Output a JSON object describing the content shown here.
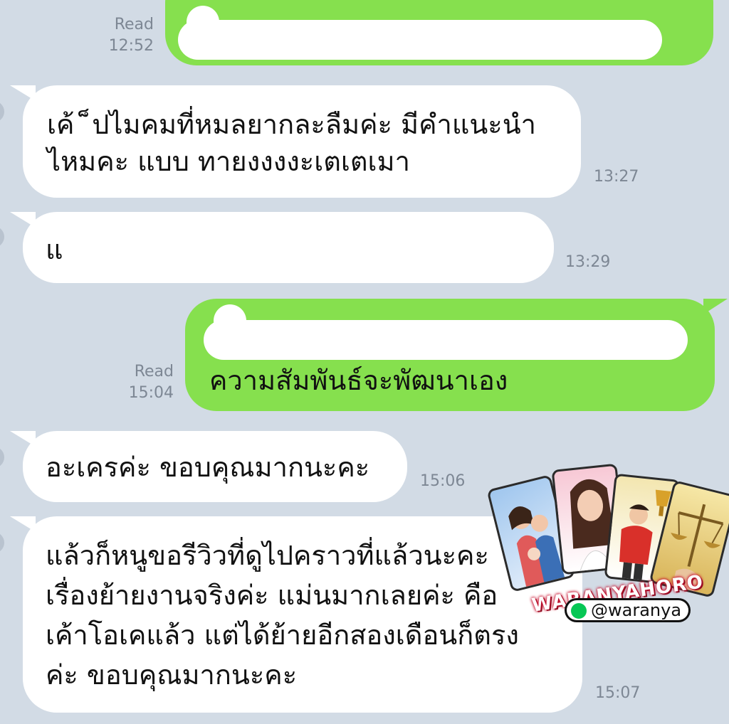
{
  "colors": {
    "background": "#d2dbe5",
    "incoming": "#ffffff",
    "outgoing": "#86e04e",
    "meta": "#7d8794"
  },
  "messages": [
    {
      "id": "m1",
      "direction": "out",
      "read_label": "Read",
      "time": "12:52",
      "lines": []
    },
    {
      "id": "m2",
      "direction": "in",
      "time": "13:27",
      "lines": [
        "เค้  ็ปไมคมที่หมลยากละลืมค่ะ มีคำแนะนำ",
        "ไหมคะ แบบ ทายงงงงะเตเตเมา"
      ]
    },
    {
      "id": "m3",
      "direction": "in",
      "time": "13:29",
      "lines": [
        "แ"
      ]
    },
    {
      "id": "m4",
      "direction": "out",
      "read_label": "Read",
      "time": "15:04",
      "lines": [
        "ความสัมพันธ์จะพัฒนาเอง"
      ]
    },
    {
      "id": "m5",
      "direction": "in",
      "time": "15:06",
      "lines": [
        "อะเครค่ะ ขอบคุณมากนะคะ"
      ]
    },
    {
      "id": "m6",
      "direction": "in",
      "time": "15:07",
      "lines": [
        "แล้วก็หนูขอรีวิวที่ดูไปคราวที่แล้วนะคะ",
        "เรื่องย้ายงานจริงค่ะ แม่นมากเลยค่ะ คือ",
        "เค้าโอเคแล้ว แต่ได้ย้ายอีกสองเดือนก็ตรง",
        "ค่ะ ขอบคุณมากนะคะ"
      ]
    }
  ],
  "watermark": {
    "brand": "WARANYAHORO",
    "handle": "@waranya",
    "icon": "line-icon"
  }
}
